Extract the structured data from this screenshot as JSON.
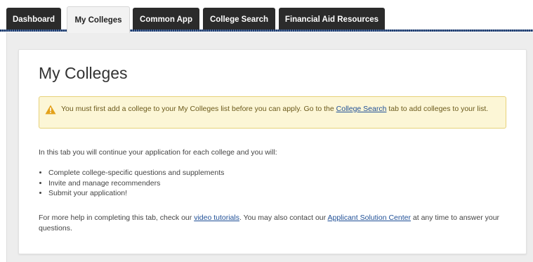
{
  "tabs": [
    {
      "label": "Dashboard",
      "active": false
    },
    {
      "label": "My Colleges",
      "active": true
    },
    {
      "label": "Common App",
      "active": false
    },
    {
      "label": "College Search",
      "active": false
    },
    {
      "label": "Financial Aid Resources",
      "active": false
    }
  ],
  "page": {
    "title": "My Colleges"
  },
  "alert": {
    "icon": "warning-icon",
    "text_before": "You must first add a college to your My Colleges list before you can apply. Go to the ",
    "link": "College Search",
    "text_after": " tab to add colleges to your list."
  },
  "intro": "In this tab you will continue your application for each college and you will:",
  "bullets": [
    "Complete college-specific questions and supplements",
    "Invite and manage recommenders",
    "Submit your application!"
  ],
  "help": {
    "text_1": "For more help in completing this tab, check our ",
    "link_1": "video tutorials",
    "text_2": ". You may also contact our ",
    "link_2": "Applicant Solution Center",
    "text_3": " at any time to answer your questions."
  },
  "colors": {
    "tab_dark": "#2b2b2b",
    "alert_bg": "#fcf6d6",
    "alert_border": "#e7d27a",
    "link": "#1f4f96",
    "warning": "#e3a11b"
  }
}
